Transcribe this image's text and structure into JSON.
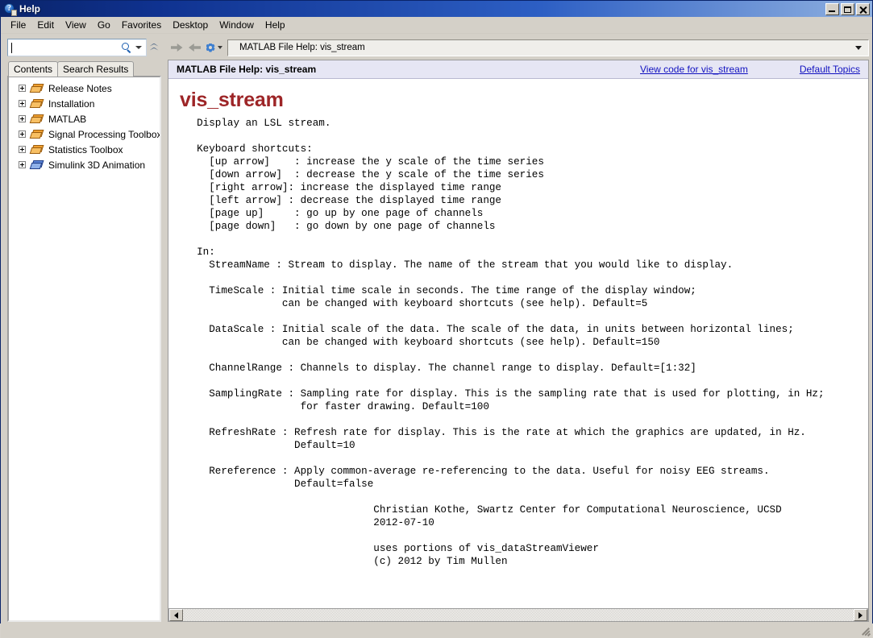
{
  "window": {
    "title": "Help",
    "icon": "help-question-icon",
    "controls": {
      "minimize": "Minimize",
      "maximize": "Maximize",
      "close": "Close"
    }
  },
  "menubar": {
    "items": [
      {
        "label": "File"
      },
      {
        "label": "Edit"
      },
      {
        "label": "View"
      },
      {
        "label": "Go"
      },
      {
        "label": "Favorites"
      },
      {
        "label": "Desktop"
      },
      {
        "label": "Window"
      },
      {
        "label": "Help"
      }
    ]
  },
  "sidebar": {
    "search": {
      "value": "",
      "placeholder": "",
      "icon": "search-icon",
      "dropdown_icon": "chevron-down-icon"
    },
    "collapse_icon": "double-chevron-up-icon",
    "tabs": [
      {
        "label": "Contents",
        "active": true
      },
      {
        "label": "Search Results",
        "active": false
      }
    ],
    "tree": [
      {
        "label": "Release Notes",
        "icon": "book-icon-orange",
        "expander": "plus-icon"
      },
      {
        "label": "Installation",
        "icon": "book-icon-orange",
        "expander": "plus-icon"
      },
      {
        "label": "MATLAB",
        "icon": "book-icon-orange",
        "expander": "plus-icon"
      },
      {
        "label": "Signal Processing Toolbox",
        "icon": "book-icon-orange",
        "expander": "plus-icon"
      },
      {
        "label": "Statistics Toolbox",
        "icon": "book-icon-orange",
        "expander": "plus-icon"
      },
      {
        "label": "Simulink 3D Animation",
        "icon": "book-icon-blue",
        "expander": "plus-icon"
      }
    ]
  },
  "toolbar": {
    "back_icon": "arrow-left-icon",
    "forward_icon": "arrow-right-icon",
    "settings_icon": "gear-icon",
    "settings_dropdown_icon": "chevron-down-icon",
    "address_value": "MATLAB File Help: vis_stream",
    "address_dropdown_icon": "chevron-down-icon"
  },
  "doc_header": {
    "title": "MATLAB File Help: vis_stream",
    "view_code_link": "View code for vis_stream",
    "default_topics_link": "Default Topics"
  },
  "document": {
    "title": "vis_stream",
    "body": "  Display an LSL stream.\n\n  Keyboard shortcuts:\n    [up arrow]    : increase the y scale of the time series\n    [down arrow]  : decrease the y scale of the time series\n    [right arrow]: increase the displayed time range\n    [left arrow] : decrease the displayed time range\n    [page up]     : go up by one page of channels\n    [page down]   : go down by one page of channels\n\n  In:\n    StreamName : Stream to display. The name of the stream that you would like to display.\n\n    TimeScale : Initial time scale in seconds. The time range of the display window;\n                can be changed with keyboard shortcuts (see help). Default=5\n\n    DataScale : Initial scale of the data. The scale of the data, in units between horizontal lines;\n                can be changed with keyboard shortcuts (see help). Default=150\n\n    ChannelRange : Channels to display. The channel range to display. Default=[1:32]\n\n    SamplingRate : Sampling rate for display. This is the sampling rate that is used for plotting, in Hz;\n                   for faster drawing. Default=100\n\n    RefreshRate : Refresh rate for display. This is the rate at which the graphics are updated, in Hz.\n                  Default=10\n\n    Rereference : Apply common-average re-referencing to the data. Useful for noisy EEG streams.\n                  Default=false\n\n                               Christian Kothe, Swartz Center for Computational Neuroscience, UCSD\n                               2012-07-10\n\n                               uses portions of vis_dataStreamViewer\n                               (c) 2012 by Tim Mullen"
  },
  "scrollbar": {
    "left_arrow_icon": "arrow-left-icon",
    "right_arrow_icon": "arrow-right-icon"
  },
  "colors": {
    "titlebar_start": "#0a246a",
    "titlebar_end": "#8fb0e0",
    "window_face": "#d4d0c8",
    "doc_title": "#9d2527",
    "link": "#1212c0",
    "header_band": "#e6e6f4",
    "book_orange": "#f0a030",
    "book_blue": "#5d86d8"
  }
}
